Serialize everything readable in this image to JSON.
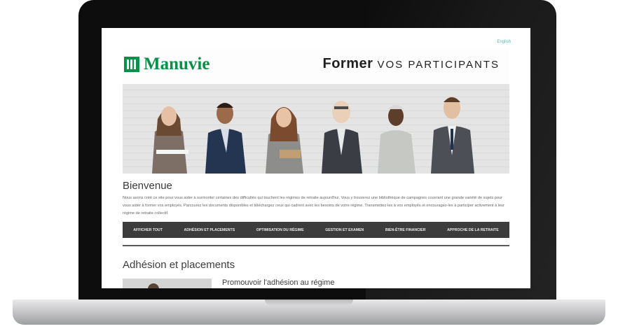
{
  "page": {
    "language_link": "English"
  },
  "banner": {
    "brand": "Manuvie",
    "tagline_bold": "Former",
    "tagline_rest": "VOS PARTICIPANTS"
  },
  "welcome": {
    "title": "Bienvenue",
    "text": "Nous avons créé ce site pour vous aider à surmonter certaines des difficultés qui touchent les régimes de retraite aujourd'hui. Vous y trouverez une bibliothèque de campagnes couvrant une grande variété de sujets pour vous aider à former vos employés. Parcourez les documents disponibles et téléchargez ceux qui cadrent avec les besoins de votre régime. Transmettez-les à vos employés et encouragez-les à participer activement à leur régime de retraite collectif."
  },
  "nav": {
    "items": [
      "AFFICHER TOUT",
      "ADHÉSION ET PLACEMENTS",
      "OPTIMISATION DU RÉGIME",
      "GESTION ET EXAMEN",
      "BIEN-ÊTRE FINANCIER",
      "APPROCHE DE LA RETRAITE"
    ]
  },
  "section": {
    "title": "Adhésion et placements",
    "first_card_title": "Promouvoir l'adhésion au régime"
  },
  "colors": {
    "brand_green": "#0d8f4a",
    "nav_background": "#3c3c3c",
    "link": "#57b7b7"
  }
}
